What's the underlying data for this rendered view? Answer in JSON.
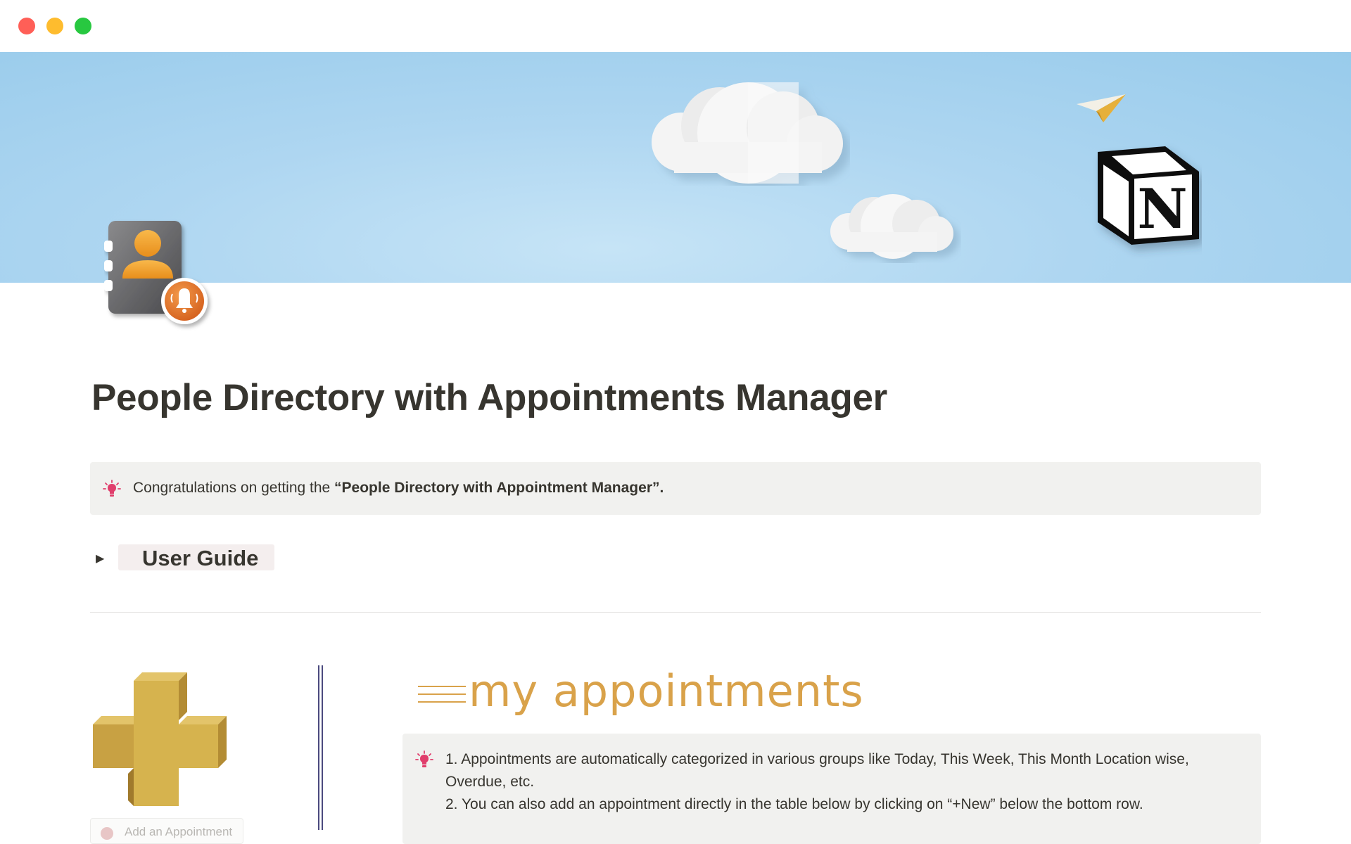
{
  "window": {
    "controls": [
      "close",
      "minimize",
      "maximize"
    ]
  },
  "cover": {
    "decorations": [
      "cloud-large",
      "cloud-small",
      "paper-plane-icon",
      "notion-logo-icon"
    ],
    "notion_logo_letter": "N"
  },
  "page": {
    "icon": "contact-book-bell-icon",
    "title": "People Directory with Appointments Manager"
  },
  "intro_callout": {
    "icon": "lightbulb-icon",
    "text_prefix": "Congratulations on getting the ",
    "text_bold": "“People Directory with Appointment Manager”."
  },
  "user_guide": {
    "toggle_icon": "triangle-right-icon",
    "label": "User Guide"
  },
  "left_column": {
    "art": "golden-plus-icon",
    "add_button_label": "Add an Appointment"
  },
  "appointments": {
    "heading": "my appointments",
    "heading_icon": "menu-lines-icon",
    "callout_icon": "lightbulb-icon",
    "lines": [
      "1. Appointments are automatically categorized in various groups like Today, This Week, This Month Location wise,",
      "Overdue, etc.",
      "2. You can also add an appointment directly in the table below by clicking on “+New” below the bottom row."
    ]
  },
  "colors": {
    "text": "#37352f",
    "callout_bg": "#f1f1ef",
    "accent_gold": "#d9a24a",
    "lightbulb": "#e03e6c",
    "divider": "#e3e2e0",
    "sky": "#aed6f1"
  }
}
